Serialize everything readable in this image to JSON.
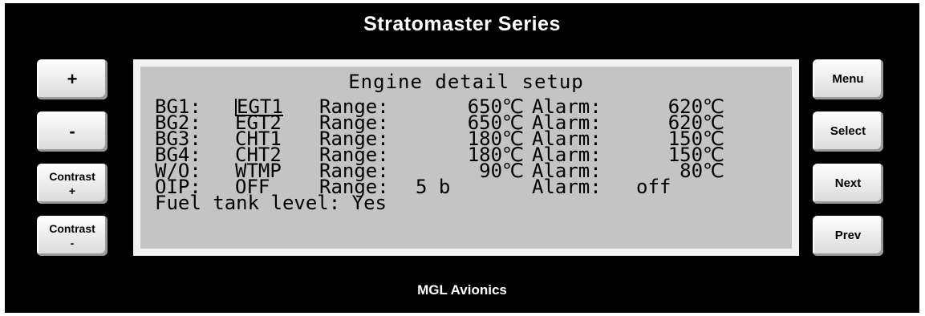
{
  "header": {
    "title": "Stratomaster Series"
  },
  "footer": {
    "brand": "MGL Avionics"
  },
  "left_buttons": [
    {
      "label": "+"
    },
    {
      "label": "-"
    },
    {
      "label": "Contrast\n+"
    },
    {
      "label": "Contrast\n-"
    }
  ],
  "right_buttons": [
    {
      "label": "Menu"
    },
    {
      "label": "Select"
    },
    {
      "label": "Next"
    },
    {
      "label": "Prev"
    }
  ],
  "lcd": {
    "heading": "Engine detail setup",
    "rows": [
      {
        "label": "BG1:",
        "source": "EGT1",
        "range_label": "Range:",
        "range": "650℃",
        "alarm_label": "Alarm:",
        "alarm": "620℃"
      },
      {
        "label": "BG2:",
        "source": "EGT2",
        "range_label": "Range:",
        "range": "650℃",
        "alarm_label": "Alarm:",
        "alarm": "620℃"
      },
      {
        "label": "BG3:",
        "source": "CHT1",
        "range_label": "Range:",
        "range": "180℃",
        "alarm_label": "Alarm:",
        "alarm": "150℃"
      },
      {
        "label": "BG4:",
        "source": "CHT2",
        "range_label": "Range:",
        "range": "180℃",
        "alarm_label": "Alarm:",
        "alarm": "150℃"
      },
      {
        "label": "W/O:",
        "source": "WTMP",
        "range_label": "Range:",
        "range": "90℃",
        "alarm_label": "Alarm:",
        "alarm": "80℃"
      }
    ],
    "oip": {
      "label": "OIP:",
      "source": "OFF",
      "range_label": "Range:",
      "range": "5 b",
      "alarm_label": "Alarm:",
      "alarm": "off"
    },
    "fuel": {
      "text": "Fuel tank level: Yes"
    }
  }
}
